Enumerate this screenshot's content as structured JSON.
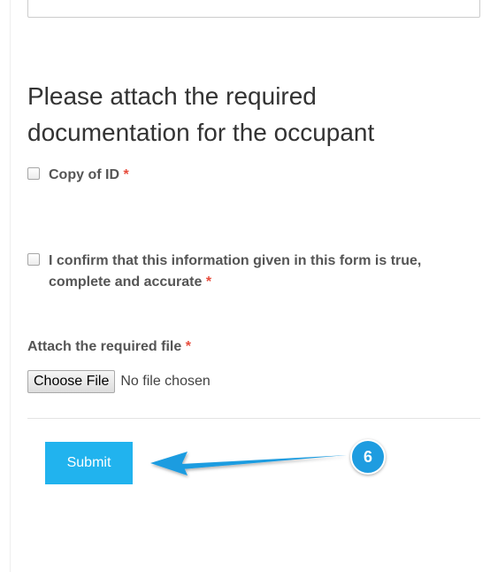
{
  "form": {
    "section_heading": "Please attach the required documentation for the occupant",
    "checkbox_copy_id": {
      "label": "Copy of ID",
      "required_mark": "*",
      "checked": false
    },
    "checkbox_confirm": {
      "label": "I confirm that this information given in this form is true, complete and accurate",
      "required_mark": "*",
      "checked": false
    },
    "attach_label": "Attach the required file",
    "attach_required_mark": "*",
    "file_input": {
      "button_label": "Choose File",
      "status": "No file chosen"
    },
    "submit_label": "Submit"
  },
  "annotation": {
    "step_number": "6",
    "color": "#1e9ce0"
  },
  "colors": {
    "accent": "#21b3ee",
    "required": "#e74c3c"
  }
}
